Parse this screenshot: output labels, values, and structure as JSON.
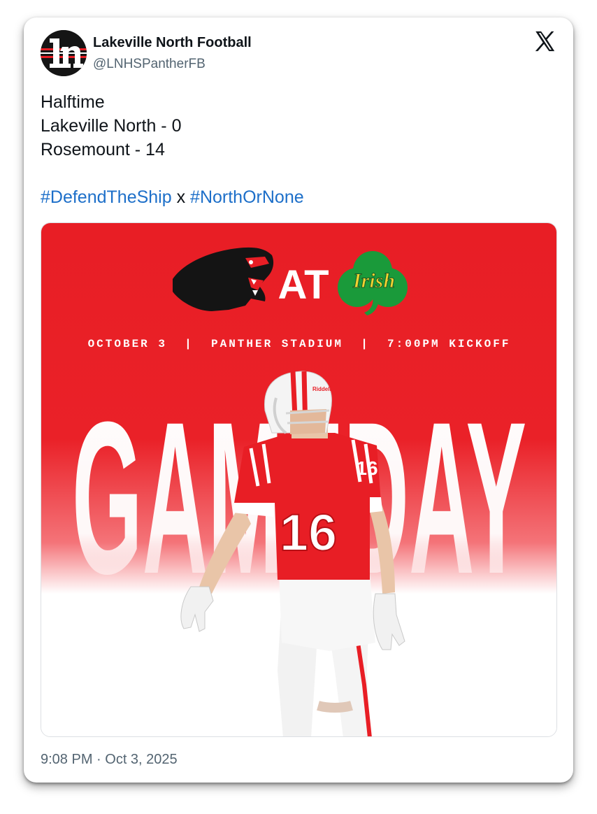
{
  "account": {
    "display_name": "Lakeville North Football",
    "handle": "@LNHSPantherFB",
    "avatar_icon": "ln-logo-icon",
    "platform_icon": "x-logo-icon"
  },
  "tweet": {
    "lines": [
      "Halftime",
      "Lakeville North - 0",
      "Rosemount - 14"
    ],
    "hashtag_1": "#DefendTheShip",
    "separator": "x",
    "hashtag_2": "#NorthOrNone",
    "timestamp": "9:08 PM · Oct 3, 2025"
  },
  "graphic": {
    "at_text": "AT",
    "irish_text": "Irish",
    "info_line": "OCTOBER 3  |  PANTHER STADIUM  |  7:00PM KICKOFF",
    "big_word": "GAMEDAY",
    "jersey_number": "16",
    "helmet_brand": "Riddell",
    "colors": {
      "red": "#e81e25",
      "shamrock_green": "#1a9a3a",
      "irish_gold": "#f2d231",
      "hashtag_blue": "#1d6fc9"
    }
  }
}
